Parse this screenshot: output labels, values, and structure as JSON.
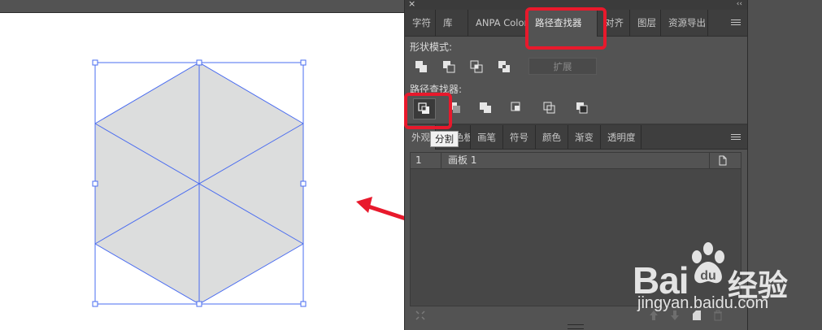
{
  "panel": {
    "tabs": [
      "字符",
      "库",
      "ANPA Color",
      "路径查找器",
      "对齐",
      "图层",
      "资源导出"
    ],
    "active_tab": "路径查找器",
    "shape_modes_label": "形状模式:",
    "expand_label": "扩展",
    "pathfinders_label": "路径查找器:",
    "tabs2": [
      "外观",
      "色板",
      "画笔",
      "符号",
      "颜色",
      "渐变",
      "透明度"
    ],
    "tooltip": "分割",
    "artboard_row": {
      "number": "1",
      "name": "画板 1"
    }
  },
  "watermark": {
    "logo": "Bai",
    "logo_suffix": "du",
    "cn": "经验",
    "url": "jingyan.baidu.com"
  },
  "colors": {
    "highlight": "#e8192c",
    "selection": "#4a6cf0",
    "shape_fill": "#dcdddd"
  },
  "icons": [
    "close-icon",
    "collapse-icon",
    "panel-menu-icon",
    "unite-icon",
    "minus-front-icon",
    "intersect-icon",
    "exclude-icon",
    "divide-icon",
    "trim-icon",
    "merge-icon",
    "crop-icon",
    "outline-icon",
    "minus-back-icon",
    "new-artboard-icon",
    "move-up-icon",
    "move-down-icon",
    "delete-icon",
    "arrow-annotation"
  ]
}
